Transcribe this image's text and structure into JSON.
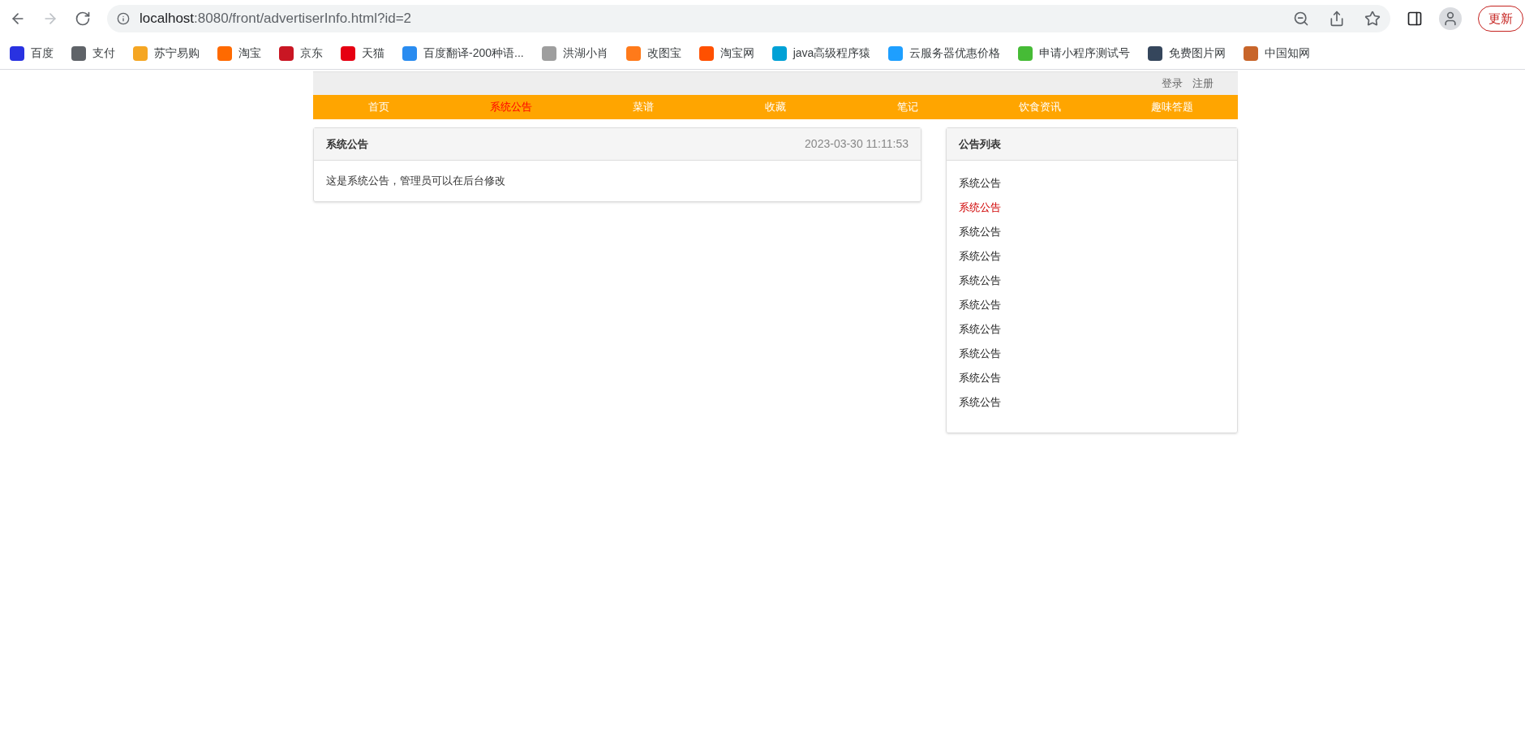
{
  "browser": {
    "url_host": "localhost",
    "url_rest": ":8080/front/advertiserInfo.html?id=2",
    "update_button": "更新",
    "bookmarks": [
      {
        "label": "百度",
        "color": "#2932e1"
      },
      {
        "label": "支付",
        "color": "#5f6368"
      },
      {
        "label": "苏宁易购",
        "color": "#f5a623"
      },
      {
        "label": "淘宝",
        "color": "#ff6a00"
      },
      {
        "label": "京东",
        "color": "#c91623"
      },
      {
        "label": "天猫",
        "color": "#e60012"
      },
      {
        "label": "百度翻译-200种语...",
        "color": "#2a8cf0"
      },
      {
        "label": "洪湖小肖",
        "color": "#9e9e9e"
      },
      {
        "label": "改图宝",
        "color": "#ff7a1a"
      },
      {
        "label": "淘宝网",
        "color": "#ff5000"
      },
      {
        "label": "java高级程序猿",
        "color": "#00a1d6"
      },
      {
        "label": "云服务器优惠价格",
        "color": "#1e9fff"
      },
      {
        "label": "申请小程序测试号",
        "color": "#46bb36"
      },
      {
        "label": "免费图片网",
        "color": "#35465c"
      },
      {
        "label": "中国知网",
        "color": "#c8652a"
      }
    ]
  },
  "top_bar": {
    "links": [
      "登录",
      "注册"
    ]
  },
  "nav": [
    {
      "label": "首页",
      "selected": false
    },
    {
      "label": "系统公告",
      "selected": true
    },
    {
      "label": "菜谱",
      "selected": false
    },
    {
      "label": "收藏",
      "selected": false
    },
    {
      "label": "笔记",
      "selected": false
    },
    {
      "label": "饮食资讯",
      "selected": false
    },
    {
      "label": "趣味答题",
      "selected": false
    }
  ],
  "notice": {
    "title": "系统公告",
    "time": "2023-03-30 11:11:53",
    "body": "这是系统公告，管理员可以在后台修改"
  },
  "notice_list": {
    "title": "公告列表",
    "items": [
      {
        "label": "系统公告",
        "selected": false
      },
      {
        "label": "系统公告",
        "selected": true
      },
      {
        "label": "系统公告",
        "selected": false
      },
      {
        "label": "系统公告",
        "selected": false
      },
      {
        "label": "系统公告",
        "selected": false
      },
      {
        "label": "系统公告",
        "selected": false
      },
      {
        "label": "系统公告",
        "selected": false
      },
      {
        "label": "系统公告",
        "selected": false
      },
      {
        "label": "系统公告",
        "selected": false
      },
      {
        "label": "系统公告",
        "selected": false
      }
    ]
  }
}
